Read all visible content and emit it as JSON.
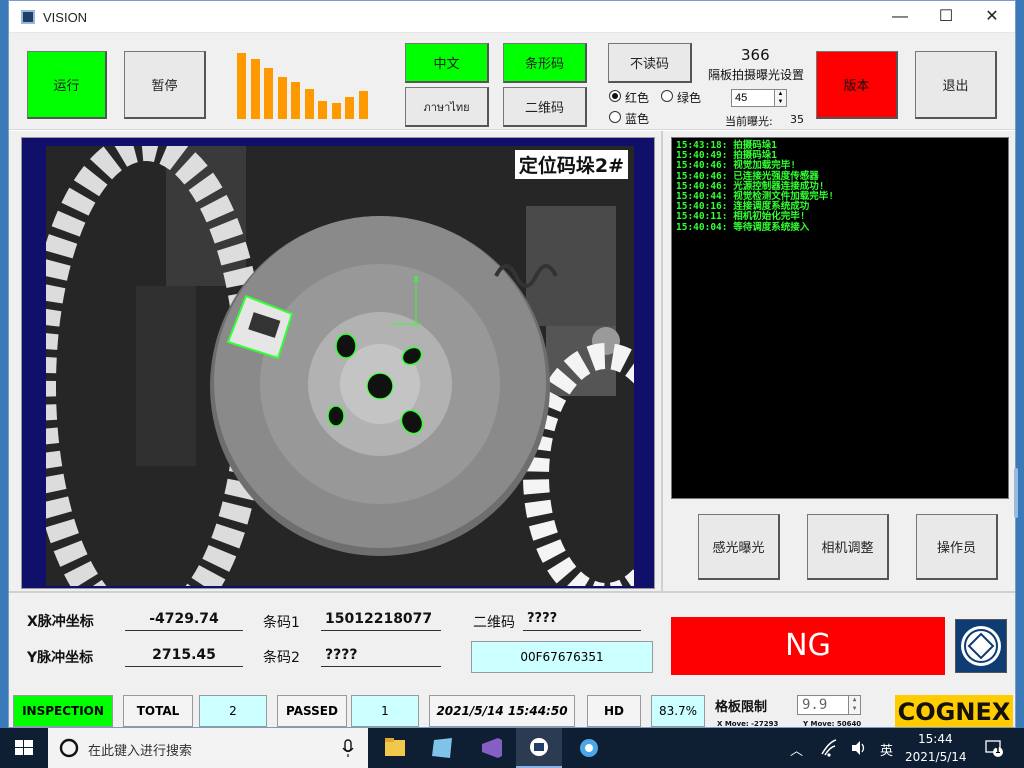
{
  "window": {
    "title": "VISION",
    "minimize": "—",
    "maximize": "☐",
    "close": "✕"
  },
  "toolbar": {
    "run": "运行",
    "pause": "暂停",
    "chinese": "中文",
    "thai": "ภาษาไทย",
    "barcode": "条形码",
    "qrcode": "二维码",
    "no_read": "不读码",
    "version": "版本",
    "exit": "退出",
    "histogram": [
      88,
      80,
      68,
      56,
      50,
      40,
      24,
      22,
      30,
      38
    ],
    "exposure_value": "366",
    "exposure_setting_label": "隔板拍摄曝光设置",
    "exposure_input": "45",
    "current_exposure_label": "当前曝光:",
    "current_exposure_value": "35",
    "colors": {
      "red_label": "红色",
      "green_label": "绿色",
      "blue_label": "蓝色",
      "selected": "红色"
    }
  },
  "camera": {
    "label": "定位码垛2#"
  },
  "log": [
    "15:43:18: 拍摄码垛1",
    "15:40:49: 拍摄码垛1",
    "15:40:46: 视觉加载完毕!",
    "15:40:46: 已连接光强度传感器",
    "15:40:46: 光源控制器连接成功!",
    "15:40:44: 视觉检测文件加载完毕!",
    "15:40:16: 连接调度系统成功",
    "15:40:11: 相机初始化完毕!",
    "15:40:04: 等待调度系统接入"
  ],
  "side_buttons": {
    "exposure": "感光曝光",
    "camera_adjust": "相机调整",
    "operator": "操作员"
  },
  "coords": {
    "x_label": "X脉冲坐标",
    "x_value": "-4729.74",
    "y_label": "Y脉冲坐标",
    "y_value": "2715.45",
    "barcode1_label": "条码1",
    "barcode1_value": "15012218077",
    "barcode2_label": "条码2",
    "barcode2_value": "????",
    "qr_label": "二维码",
    "qr_value": "????",
    "qr_hex": "00F67676351"
  },
  "result": "NG",
  "status": {
    "inspection": "INSPECTION",
    "total_label": "TOTAL",
    "total_value": "2",
    "passed_label": "PASSED",
    "passed_value": "1",
    "datetime": "2021/5/14 15:44:50",
    "hd_label": "HD",
    "hd_value": "83.7%",
    "limit_label": "格板限制",
    "limit_value": "9.9",
    "x_move": "X Move: -27293",
    "y_move": "Y Move: 50640",
    "brand": "COGNEX"
  },
  "taskbar": {
    "search_placeholder": "在此键入进行搜索",
    "ime": "英",
    "time": "15:44",
    "date": "2021/5/14",
    "notifications": "1"
  }
}
